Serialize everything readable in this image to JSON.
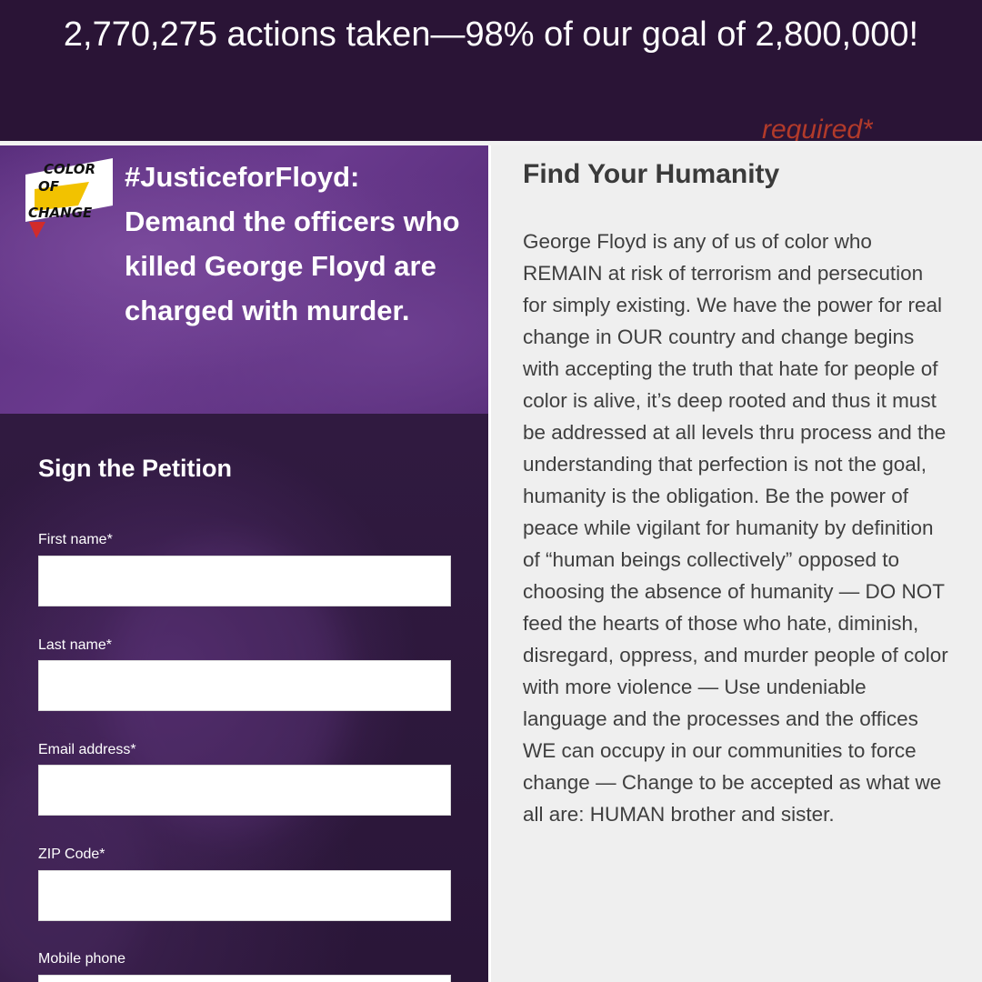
{
  "banner": {
    "progress_text": "2,770,275 actions taken—98% of our goal of 2,800,000!",
    "required_note": "required*"
  },
  "campaign": {
    "logo": {
      "line1": "COLOR",
      "line2": "OF",
      "line3": "CHANGE",
      "colors": {
        "red": "#d22b2b",
        "yellow": "#f2c200",
        "black": "#111111"
      }
    },
    "headline": "#JusticeforFloyd: Demand the officers who killed George Floyd are charged with murder."
  },
  "petition_form": {
    "title": "Sign the Petition",
    "fields": [
      {
        "label": "First name*",
        "value": ""
      },
      {
        "label": "Last name*",
        "value": ""
      },
      {
        "label": "Email address*",
        "value": ""
      },
      {
        "label": "ZIP Code*",
        "value": ""
      },
      {
        "label": "Mobile phone",
        "value": ""
      }
    ]
  },
  "statement": {
    "title": "Find Your Humanity",
    "body": "George Floyd is any of us of color who REMAIN at risk of terrorism and persecution for simply existing. We have the power for real change in OUR country and change begins with accepting the truth that hate for people of color is alive, it’s deep rooted and thus it must be addressed at all levels thru process and the understanding that perfection is not the goal, humanity is the obligation. Be the power of peace while vigilant for humanity by definition of “human beings collectively” opposed to choosing the absence of humanity — DO NOT feed the hearts of those who hate, diminish, disregard, oppress, and murder people of color with more violence — Use undeniable language and the processes and the offices WE can occupy in our communities to force change — Change to be accepted as what we all are: HUMAN brother and sister."
  },
  "colors": {
    "banner_bg": "#2a1436",
    "hero_purple": "#5a2f7d",
    "form_bg": "#2d1a3a",
    "right_bg": "#efefef",
    "accent_red": "#b23a2a"
  }
}
